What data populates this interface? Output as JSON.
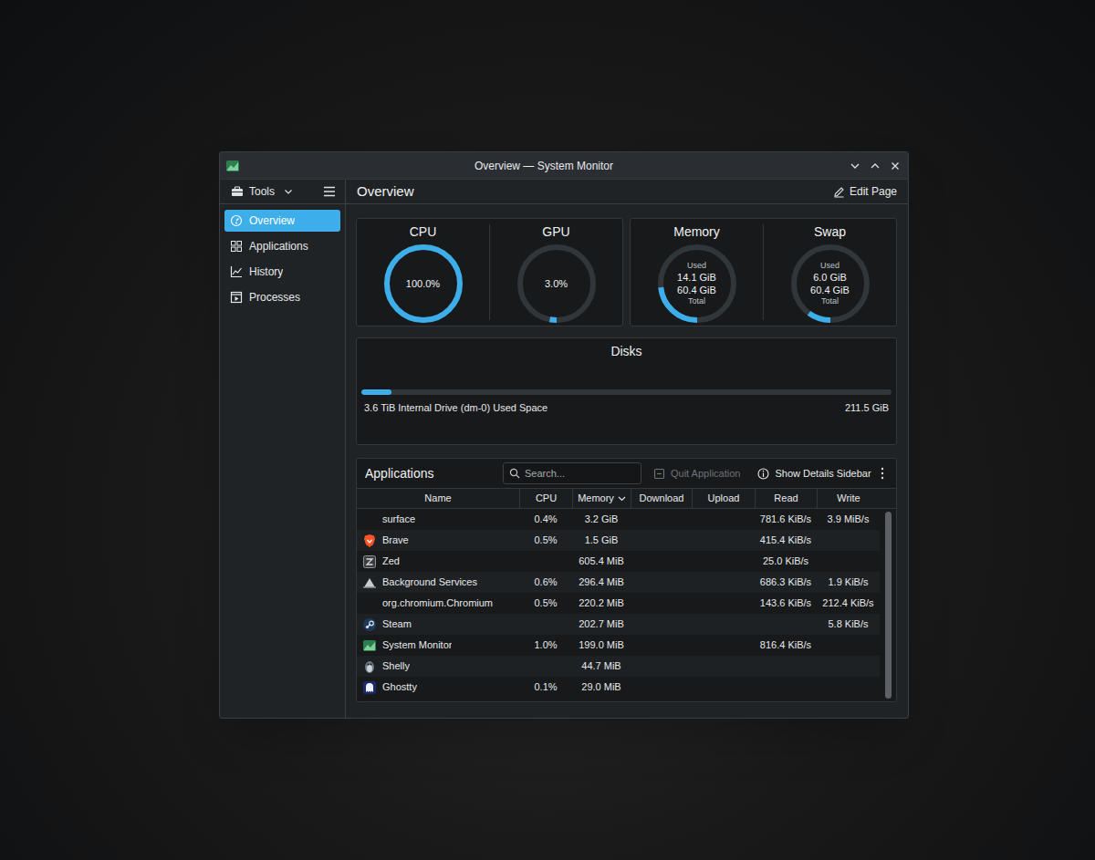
{
  "window": {
    "title": "Overview — System Monitor"
  },
  "sidebar": {
    "tools": "Tools",
    "items": [
      {
        "label": "Overview",
        "selected": true
      },
      {
        "label": "Applications",
        "selected": false
      },
      {
        "label": "History",
        "selected": false
      },
      {
        "label": "Processes",
        "selected": false
      }
    ]
  },
  "page": {
    "title": "Overview",
    "edit": "Edit Page"
  },
  "gauge_cards": [
    {
      "gauges": [
        {
          "title": "CPU",
          "level": 1.0,
          "lines": [
            {
              "text": "100.0%",
              "kind": "value"
            }
          ]
        },
        {
          "title": "GPU",
          "level": 0.03,
          "lines": [
            {
              "text": "3.0%",
              "kind": "value"
            }
          ]
        }
      ]
    },
    {
      "gauges": [
        {
          "title": "Memory",
          "level": 0.233,
          "lines": [
            {
              "text": "Used",
              "kind": "caption"
            },
            {
              "text": "14.1 GiB",
              "kind": "value"
            },
            {
              "text": "60.4 GiB",
              "kind": "value"
            },
            {
              "text": "Total",
              "kind": "caption"
            }
          ]
        },
        {
          "title": "Swap",
          "level": 0.1,
          "lines": [
            {
              "text": "Used",
              "kind": "caption"
            },
            {
              "text": "6.0 GiB",
              "kind": "value"
            },
            {
              "text": "60.4 GiB",
              "kind": "value"
            },
            {
              "text": "Total",
              "kind": "caption"
            }
          ]
        }
      ]
    }
  ],
  "disks": {
    "title": "Disks",
    "items": [
      {
        "label": "3.6 TiB Internal Drive (dm-0) Used Space",
        "value": "211.5 GiB",
        "level": 0.057
      }
    ]
  },
  "applications": {
    "title": "Applications",
    "search": {
      "placeholder": "Search..."
    },
    "actions": [
      {
        "label": "Quit Application",
        "disabled": true
      },
      {
        "label": "Show Details Sidebar",
        "disabled": false
      }
    ],
    "columns": [
      {
        "label": "Name",
        "sorted": false
      },
      {
        "label": "CPU",
        "sorted": false
      },
      {
        "label": "Memory",
        "sorted": true
      },
      {
        "label": "Download",
        "sorted": false
      },
      {
        "label": "Upload",
        "sorted": false
      },
      {
        "label": "Read",
        "sorted": false
      },
      {
        "label": "Write",
        "sorted": false
      }
    ],
    "rows": [
      {
        "name": "surface",
        "cells": [
          "0.4%",
          "3.2 GiB",
          "",
          "",
          "781.6 KiB/s",
          "3.9 MiB/s"
        ]
      },
      {
        "name": "Brave",
        "cells": [
          "0.5%",
          "1.5 GiB",
          "",
          "",
          "415.4 KiB/s",
          ""
        ]
      },
      {
        "name": "Zed",
        "cells": [
          "",
          "605.4 MiB",
          "",
          "",
          "25.0 KiB/s",
          ""
        ]
      },
      {
        "name": "Background Services",
        "cells": [
          "0.6%",
          "296.4 MiB",
          "",
          "",
          "686.3 KiB/s",
          "1.9 KiB/s"
        ]
      },
      {
        "name": "org.chromium.Chromium",
        "cells": [
          "0.5%",
          "220.2 MiB",
          "",
          "",
          "143.6 KiB/s",
          "212.4 KiB/s"
        ]
      },
      {
        "name": "Steam",
        "cells": [
          "",
          "202.7 MiB",
          "",
          "",
          "",
          "5.8 KiB/s"
        ]
      },
      {
        "name": "System Monitor",
        "cells": [
          "1.0%",
          "199.0 MiB",
          "",
          "",
          "816.4 KiB/s",
          ""
        ]
      },
      {
        "name": "Shelly",
        "cells": [
          "",
          "44.7 MiB",
          "",
          "",
          "",
          ""
        ]
      },
      {
        "name": "Ghostty",
        "cells": [
          "0.1%",
          "29.0 MiB",
          "",
          "",
          "",
          ""
        ]
      }
    ]
  }
}
